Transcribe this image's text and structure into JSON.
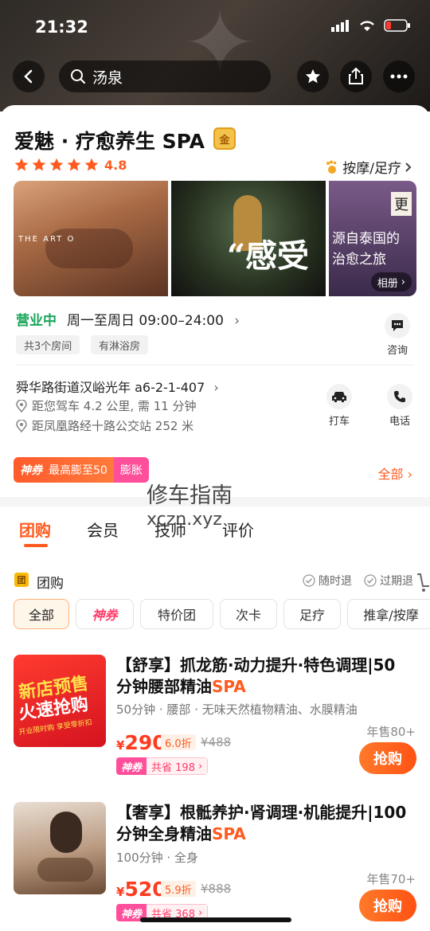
{
  "status": {
    "time": "21:32"
  },
  "search": {
    "placeholder": "汤泉"
  },
  "shop": {
    "name": "爱魅 · 疗愈养生 SPA",
    "badge": "金",
    "rating": "4.8",
    "stars": 5,
    "category": "按摩/足疗",
    "photos": {
      "photo1_text": "THE ART O",
      "photo2_text": "“感受",
      "photo3_text": "源自泰国的\n治愈之旅",
      "photo3_top": "更",
      "album_label": "相册"
    },
    "open_status": "营业中",
    "hours": "周一至周日 09:00–24:00",
    "tags": [
      "共3个房间",
      "有淋浴房"
    ],
    "consult_label": "咨询",
    "address": "舜华路街道汉峪光年 a6-2-1-407",
    "drive_distance": "距您驾车 4.2 公里, 需 11 分钟",
    "bus_distance": "距凤凰路经十路公交站 252 米",
    "taxi_label": "打车",
    "phone_label": "电话"
  },
  "coupon": {
    "brand": "神券",
    "text": "最高膨至50",
    "expand": "膨胀",
    "all_label": "全部"
  },
  "watermark": {
    "line1": "修车指南",
    "line2": "xczn.xyz"
  },
  "tabs": [
    "团购",
    "会员",
    "技师",
    "评价"
  ],
  "group": {
    "icon": "团",
    "title": "团购",
    "flag1": "随时退",
    "flag2": "过期退"
  },
  "filters": [
    "全部",
    "神券",
    "特价团",
    "次卡",
    "足疗",
    "推拿/按摩"
  ],
  "deals": [
    {
      "title_main": "【舒享】抓龙筋·动力提升·特色调理|50分钟腰部精油",
      "title_spa": "SPA",
      "sub": "50分钟 · 腰部 · 无味天然植物精油、水膜精油",
      "price": "290",
      "currency": "¥",
      "discount": "6.0折",
      "original": "¥488",
      "save_brand": "神券",
      "save_text": "共省 198",
      "sold": "年售80+",
      "buy": "抢购",
      "img_text1": "新店预售",
      "img_text2": "火速抢购",
      "img_text3": "开业限时购 享受零折扣"
    },
    {
      "title_main": "【奢享】根骶养护·肾调理·机能提升|100分钟全身精油",
      "title_spa": "SPA",
      "sub": "100分钟 · 全身",
      "price": "520",
      "currency": "¥",
      "discount": "5.9折",
      "original": "¥888",
      "save_brand": "神券",
      "save_text": "共省 368",
      "sold": "年售70+",
      "buy": "抢购"
    }
  ],
  "colors": {
    "accent": "#ff5a1f",
    "open": "#19a55a",
    "gold": "#f3c24a"
  }
}
